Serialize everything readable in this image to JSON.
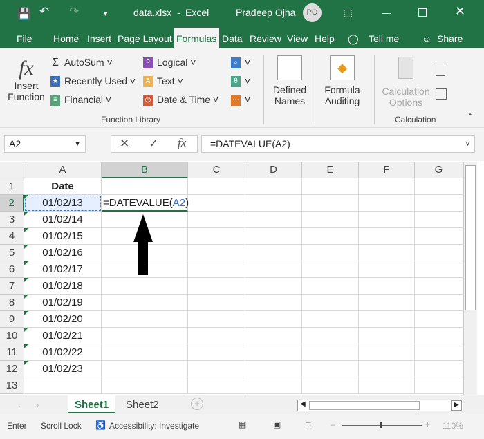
{
  "titlebar": {
    "filename": "data.xlsx",
    "separator": "-",
    "app": "Excel",
    "user": "Pradeep Ojha",
    "initials": "PO"
  },
  "tabs": [
    "File",
    "Home",
    "Insert",
    "Page Layout",
    "Formulas",
    "Data",
    "Review",
    "View",
    "Help",
    "Tell me",
    "Share"
  ],
  "ribbon": {
    "insert_function": [
      "Insert",
      "Function"
    ],
    "col1": [
      "AutoSum",
      "Recently Used",
      "Financial"
    ],
    "col2": [
      "Logical",
      "Text",
      "Date & Time"
    ],
    "defined_names": [
      "Defined",
      "Names"
    ],
    "formula_auditing": [
      "Formula",
      "Auditing"
    ],
    "calc_options": [
      "Calculation",
      "Options"
    ],
    "groups": {
      "function_library": "Function Library",
      "calculation": "Calculation"
    }
  },
  "formula_bar": {
    "name_box": "A2",
    "formula": "=DATEVALUE(A2)",
    "fx": "fx"
  },
  "columns": [
    "A",
    "B",
    "C",
    "D",
    "E",
    "F",
    "G"
  ],
  "rows": [
    "1",
    "2",
    "3",
    "4",
    "5",
    "6",
    "7",
    "8",
    "9",
    "10",
    "11",
    "12",
    "13"
  ],
  "cells": {
    "A1": "Date",
    "A": [
      "01/02/13",
      "01/02/14",
      "01/02/15",
      "01/02/16",
      "01/02/17",
      "01/02/18",
      "01/02/19",
      "01/02/20",
      "01/02/21",
      "01/02/22",
      "01/02/23"
    ],
    "B2": {
      "prefix": "=DATEVALUE(",
      "ref": "A2",
      "suffix": ")"
    }
  },
  "sheets": [
    "Sheet1",
    "Sheet2"
  ],
  "status": {
    "mode": "Enter",
    "scroll_lock": "Scroll Lock",
    "accessibility": "Accessibility: Investigate",
    "zoom": "110%"
  },
  "colors": {
    "brand": "#217346",
    "ref": "#3a6fc4"
  }
}
